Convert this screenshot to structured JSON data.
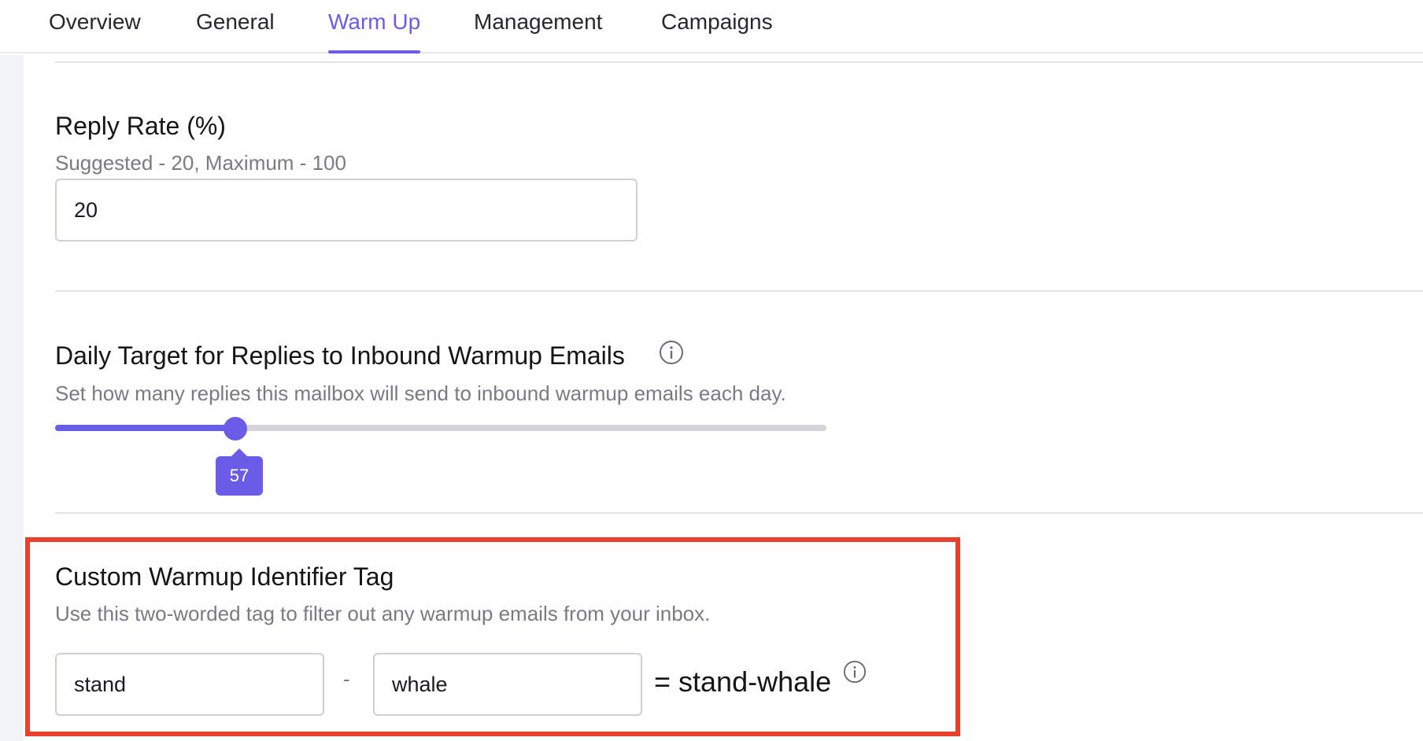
{
  "tabs": [
    {
      "label": "Overview"
    },
    {
      "label": "General"
    },
    {
      "label": "Warm Up",
      "active": true
    },
    {
      "label": "Management"
    },
    {
      "label": "Campaigns"
    }
  ],
  "reply_rate": {
    "title": "Reply Rate (%)",
    "hint": "Suggested - 20, Maximum - 100",
    "value": "20"
  },
  "daily_target": {
    "title": "Daily Target for Replies to Inbound Warmup Emails",
    "description": "Set how many replies this mailbox will send to inbound warmup emails each day.",
    "slider_value": "57",
    "slider_fraction": 0.235
  },
  "custom_tag": {
    "title": "Custom Warmup Identifier Tag",
    "description": "Use this two-worded tag to filter out any warmup emails from your inbox.",
    "first_word": "stand",
    "separator": "-",
    "second_word": "whale",
    "result": "= stand-whale"
  },
  "colors": {
    "accent": "#6b5ce7",
    "highlight_border": "#e8402a"
  }
}
